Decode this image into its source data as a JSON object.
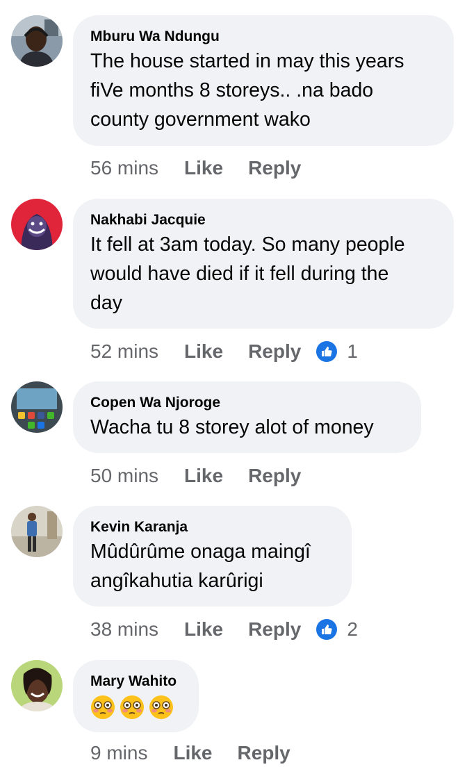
{
  "comments": [
    {
      "author": "Mburu Wa Ndungu",
      "text": "The house started in may this years\nfiVe months 8 storeys.. .na bado\ncounty government wako",
      "time": "56 mins",
      "like_label": "Like",
      "reply_label": "Reply",
      "avatar_icon": "profile-photo-man-headset"
    },
    {
      "author": "Nakhabi Jacquie",
      "text": "It fell at 3am today. So many people\nwould have died if it fell during the\nday",
      "time": "52 mins",
      "like_label": "Like",
      "reply_label": "Reply",
      "reaction_icon": "like-thumb-icon",
      "reaction_count": "1",
      "avatar_icon": "profile-photo-purple-character"
    },
    {
      "author": "Copen Wa Njoroge",
      "text": "Wacha tu 8 storey alot of money",
      "time": "50 mins",
      "like_label": "Like",
      "reply_label": "Reply",
      "avatar_icon": "profile-photo-phone-screen"
    },
    {
      "author": "Kevin Karanja",
      "text": "Mûdûrûme onaga maingî\nangîkahutia karûrigi",
      "time": "38 mins",
      "like_label": "Like",
      "reply_label": "Reply",
      "reaction_icon": "like-thumb-icon",
      "reaction_count": "2",
      "avatar_icon": "profile-photo-man-standing"
    },
    {
      "author": "Mary Wahito",
      "emojis": [
        "flushed-face-emoji",
        "flushed-face-emoji",
        "flushed-face-emoji"
      ],
      "time": "9 mins",
      "like_label": "Like",
      "reply_label": "Reply",
      "avatar_icon": "profile-photo-woman-smiling"
    }
  ],
  "colors": {
    "bubble_bg": "#f0f2f5",
    "meta_text": "#65676b",
    "like_blue": "#1b74e4",
    "text": "#050505"
  }
}
